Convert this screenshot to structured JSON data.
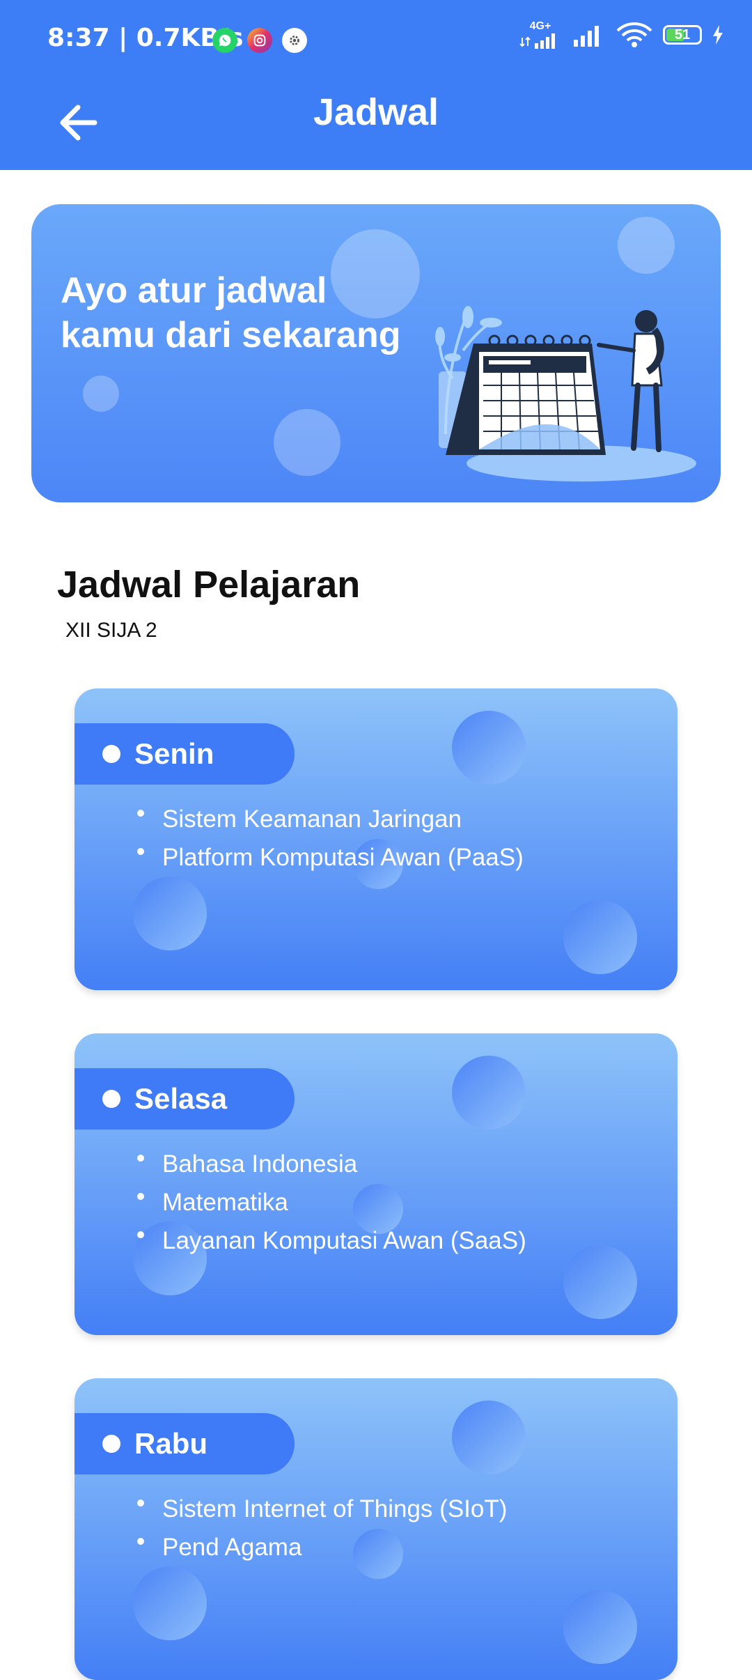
{
  "status_bar": {
    "time_speed": "8:37 | 0.7KB/s",
    "network_label": "4G+",
    "battery": "51",
    "icons": [
      "whatsapp-icon",
      "instagram-icon",
      "settings-icon",
      "signal-icon",
      "wifi-icon",
      "battery-icon",
      "charging-icon"
    ]
  },
  "app_bar": {
    "title": "Jadwal",
    "back_icon": "arrow-left-icon"
  },
  "banner": {
    "title_line1": "Ayo atur jadwal",
    "title_line2": "kamu dari sekarang",
    "illustration": "calendar-illustration"
  },
  "schedule": {
    "title": "Jadwal Pelajaran",
    "class_name": "XII SIJA 2",
    "days": [
      {
        "day": "Senin",
        "subjects": [
          "Sistem Keamanan Jaringan",
          "Platform Komputasi Awan (PaaS)"
        ]
      },
      {
        "day": "Selasa",
        "subjects": [
          "Bahasa Indonesia",
          "Matematika",
          "Layanan Komputasi Awan (SaaS)"
        ]
      },
      {
        "day": "Rabu",
        "subjects": [
          "Sistem Internet of Things (SIoT)",
          "Pend Agama"
        ]
      }
    ]
  },
  "colors": {
    "primary": "#3d7ef7",
    "card_top": "#8ec3f9",
    "card_bottom": "#447ff6"
  }
}
